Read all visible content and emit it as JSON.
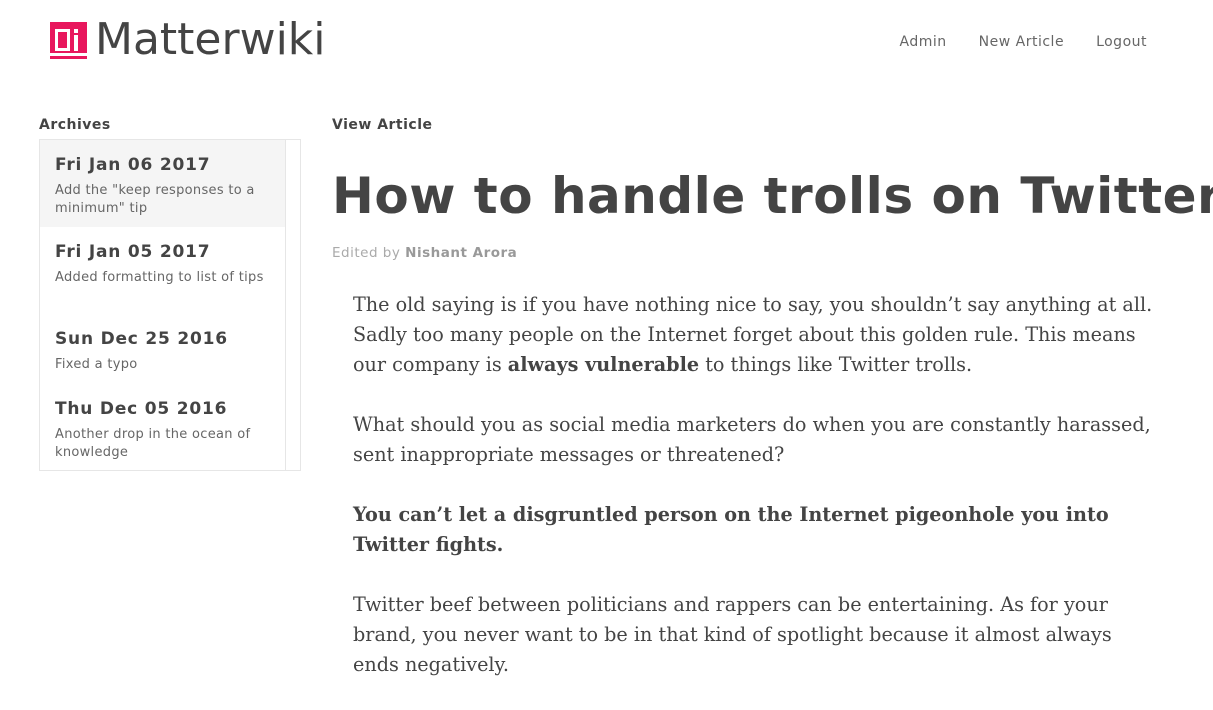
{
  "header": {
    "logo_text": "Matterwiki",
    "brand_color": "#e8175d",
    "nav": [
      "Admin",
      "New Article",
      "Logout"
    ]
  },
  "sidebar": {
    "label": "Archives",
    "items": [
      {
        "date": "Fri Jan 06 2017",
        "message": "Add the \"keep responses to a minimum\" tip"
      },
      {
        "date": "Fri Jan 05 2017",
        "message": "Added formatting to list of tips"
      },
      {
        "date": "Sun Dec 25 2016",
        "message": "Fixed a typo"
      },
      {
        "date": "Thu Dec 05 2016",
        "message": "Another drop in the ocean of knowledge"
      }
    ]
  },
  "article": {
    "section_label": "View Article",
    "title": "How to handle trolls on Twitter",
    "edited_prefix": "Edited by",
    "author": "Nishant Arora",
    "p1_a": "The old saying is if you have nothing nice to say, you shouldn’t say anything at all. Sadly too many people on the Internet forget about this golden rule. This means our company is ",
    "p1_bold": "always vulnerable",
    "p1_b": " to things like Twitter trolls.",
    "p2": "What should you as social media marketers do when you are constantly harassed, sent inappropriate messages or threatened?",
    "p3_bold": "You can’t let a disgruntled person on the Internet pigeonhole you into Twitter fights.",
    "p4": "Twitter beef between politicians and rappers can be entertaining. As for your brand, you never want to be in that kind of spotlight because it almost always ends negatively."
  }
}
